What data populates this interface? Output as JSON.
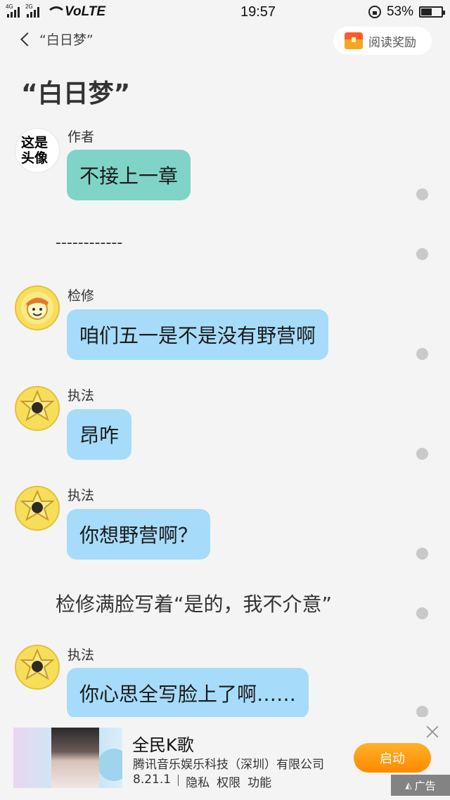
{
  "status_bar": {
    "signal1_tag": "4G",
    "signal2_tag": "2G",
    "network": "VoLTE",
    "time": "19:57",
    "battery": "53%",
    "battery_level": 0.53
  },
  "header": {
    "back_label": "“白日梦”",
    "reward_label": "阅读奖励"
  },
  "page_title": "“白日梦”",
  "messages": [
    {
      "speaker": "作者",
      "text": "不接上一章",
      "bubble": "teal",
      "avatar": "这是头像"
    },
    {
      "narration": "------------"
    },
    {
      "speaker": "检修",
      "text": "咱们五一是不是没有野营啊",
      "bubble": "blue"
    },
    {
      "speaker": "执法",
      "text": "昂咋",
      "bubble": "blue"
    },
    {
      "speaker": "执法",
      "text": "你想野营啊？",
      "bubble": "blue"
    },
    {
      "narration": "检修满脸写着“是的，我不介意”"
    },
    {
      "speaker": "执法",
      "text": "你心思全写脸上了啊……",
      "bubble": "blue"
    }
  ],
  "ad": {
    "title": "全民K歌",
    "company": "腾讯音乐娱乐科技（深圳）有限公司",
    "version": "8.21.1",
    "privacy": "隐私",
    "permissions": "权限",
    "features": "功能",
    "launch_label": "启动",
    "badge_label": "广告"
  },
  "colors": {
    "teal_bubble": "#7fd3c7",
    "blue_bubble": "#a6dcfa",
    "launch_button": "#ff8a00"
  }
}
